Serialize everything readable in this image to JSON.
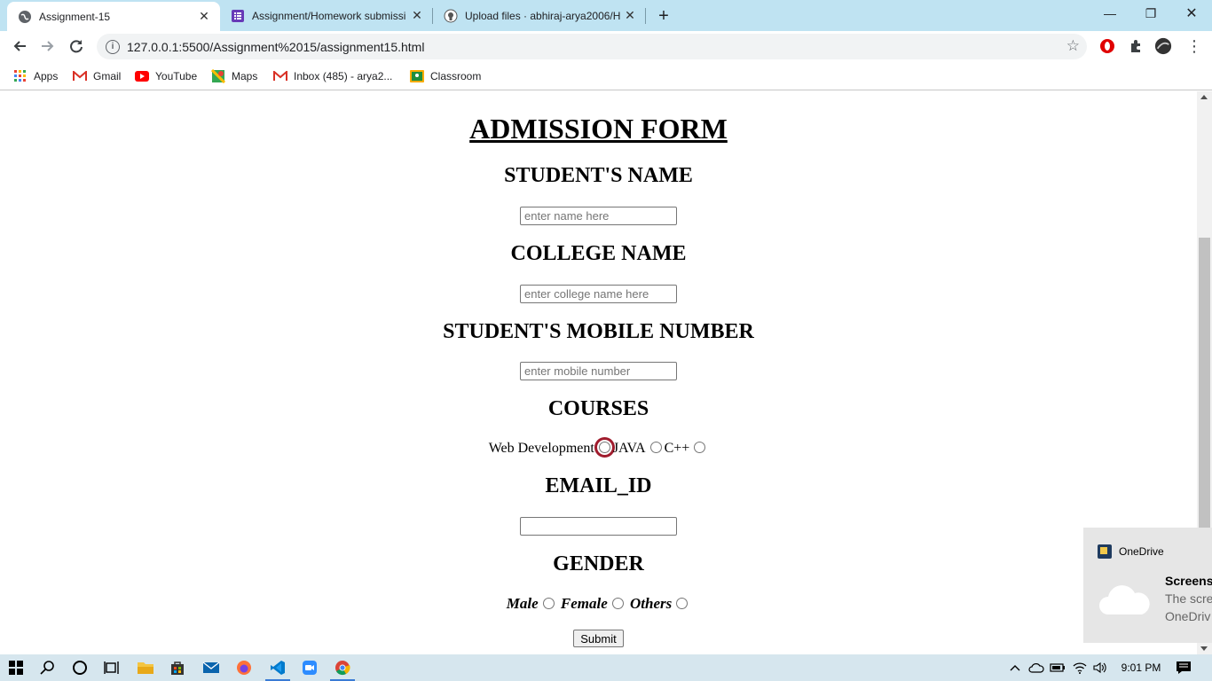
{
  "browser": {
    "tabs": [
      {
        "title": "Assignment-15",
        "active": true
      },
      {
        "title": "Assignment/Homework submissi",
        "active": false
      },
      {
        "title": "Upload files · abhiraj-arya2006/H",
        "active": false
      }
    ],
    "url": "127.0.0.1:5500/Assignment%2015/assignment15.html",
    "bookmarks": [
      "Apps",
      "Gmail",
      "YouTube",
      "Maps",
      "Inbox (485) - arya2...",
      "Classroom"
    ]
  },
  "form": {
    "title": "ADMISSION FORM",
    "student_name": {
      "label": "STUDENT'S NAME",
      "placeholder": "enter name here"
    },
    "college_name": {
      "label": "COLLEGE NAME",
      "placeholder": "enter college name here"
    },
    "mobile": {
      "label": "STUDENT'S MOBILE NUMBER",
      "placeholder": "enter mobile number"
    },
    "courses": {
      "label": "COURSES",
      "options": [
        "Web Development",
        "JAVA",
        "C++"
      ]
    },
    "email": {
      "label": "EMAIL_ID",
      "value": ""
    },
    "gender": {
      "label": "GENDER",
      "options": [
        "Male",
        "Female",
        "Others"
      ]
    },
    "submit_label": "Submit"
  },
  "toast": {
    "app": "OneDrive",
    "heading": "Screens",
    "line1": "The scre",
    "line2": "OneDriv"
  },
  "taskbar": {
    "time": "9:01 PM"
  },
  "colors": {
    "tabstrip": "#bfe3f2",
    "focus_ring": "#a01c2d",
    "taskbar": "#d6e6ee"
  }
}
